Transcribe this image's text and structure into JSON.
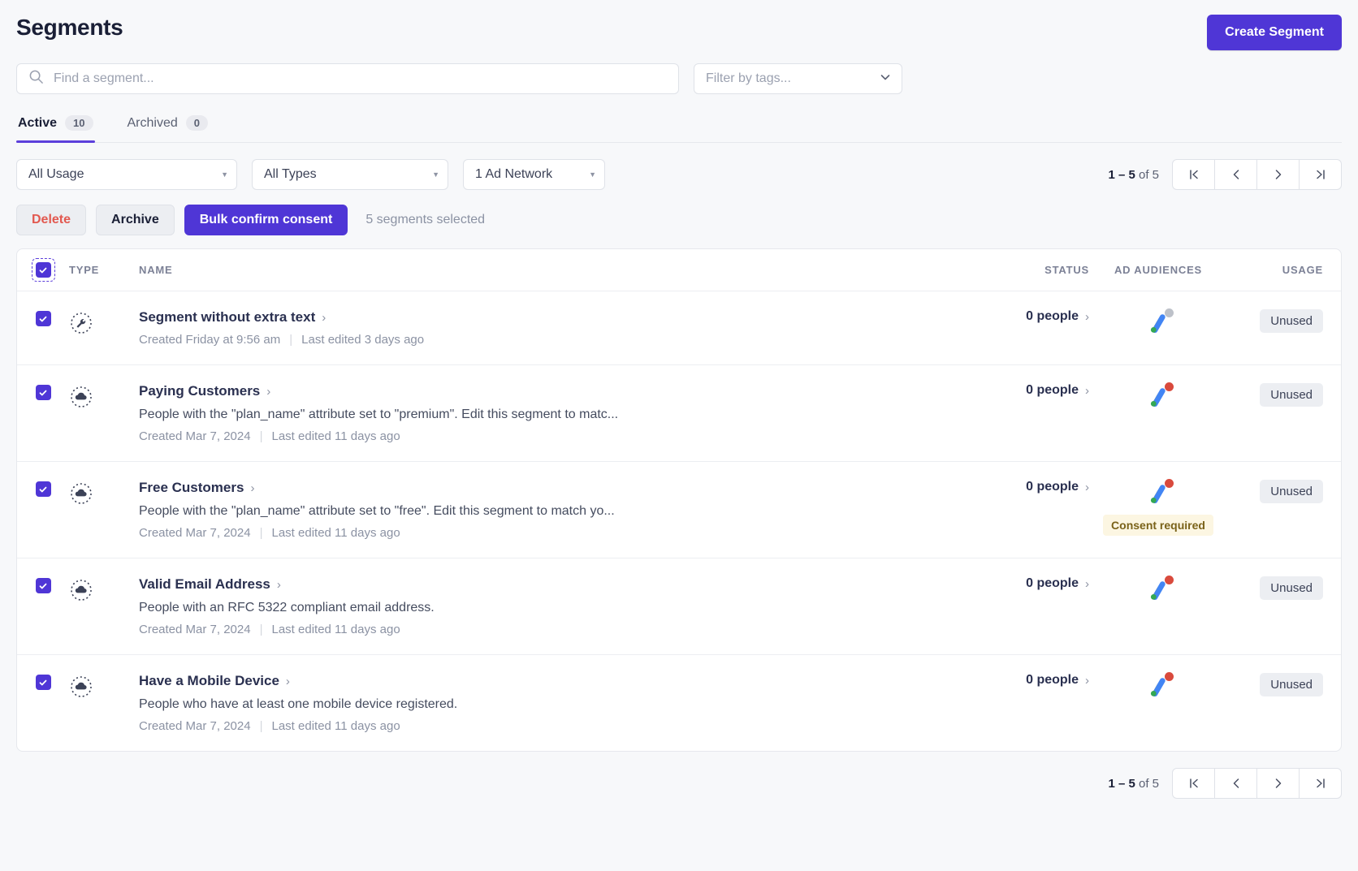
{
  "header": {
    "title": "Segments",
    "create_button": "Create Segment"
  },
  "search": {
    "placeholder": "Find a segment...",
    "value": "",
    "tag_filter_placeholder": "Filter by tags..."
  },
  "tabs": [
    {
      "label": "Active",
      "count": "10",
      "active": true
    },
    {
      "label": "Archived",
      "count": "0",
      "active": false
    }
  ],
  "filters": [
    {
      "name": "usage",
      "value": "All Usage"
    },
    {
      "name": "types",
      "value": "All Types"
    },
    {
      "name": "network",
      "value": "1 Ad Network"
    }
  ],
  "pagination": {
    "range_prefix": "1 – 5",
    "range_suffix": " of 5",
    "first_label": "first-page",
    "prev_label": "previous-page",
    "next_label": "next-page",
    "last_label": "last-page"
  },
  "bulk_actions": {
    "delete": "Delete",
    "archive": "Archive",
    "confirm_consent": "Bulk confirm consent",
    "selection_note": "5 segments selected"
  },
  "table": {
    "columns": {
      "type": "TYPE",
      "name": "NAME",
      "status": "STATUS",
      "ad_audiences": "AD AUDIENCES",
      "usage": "USAGE"
    },
    "select_all_checked": true,
    "rows": [
      {
        "checked": true,
        "type_icon": "wrench-circle-icon",
        "name": "Segment without extra text",
        "description": "",
        "created": "Created Friday at 9:56 am",
        "last_edited": "Last edited 3 days ago",
        "status": "0 people",
        "ad_network_icon": "google-ads-icon",
        "badge_color": "#bdc1c9",
        "consent_required": "",
        "usage": "Unused"
      },
      {
        "checked": true,
        "type_icon": "cloud-circle-icon",
        "name": "Paying Customers",
        "description": "People with the \"plan_name\" attribute set to \"premium\". Edit this segment to matc...",
        "created": "Created Mar 7, 2024",
        "last_edited": "Last edited 11 days ago",
        "status": "0 people",
        "ad_network_icon": "google-ads-icon",
        "badge_color": "#d94a3d",
        "consent_required": "",
        "usage": "Unused"
      },
      {
        "checked": true,
        "type_icon": "cloud-circle-icon",
        "name": "Free Customers",
        "description": "People with the \"plan_name\" attribute set to \"free\". Edit this segment to match yo...",
        "created": "Created Mar 7, 2024",
        "last_edited": "Last edited 11 days ago",
        "status": "0 people",
        "ad_network_icon": "google-ads-icon",
        "badge_color": "#d94a3d",
        "consent_required": "Consent required",
        "usage": "Unused"
      },
      {
        "checked": true,
        "type_icon": "cloud-circle-icon",
        "name": "Valid Email Address",
        "description": "People with an RFC 5322 compliant email address.",
        "created": "Created Mar 7, 2024",
        "last_edited": "Last edited 11 days ago",
        "status": "0 people",
        "ad_network_icon": "google-ads-icon",
        "badge_color": "#d94a3d",
        "consent_required": "",
        "usage": "Unused"
      },
      {
        "checked": true,
        "type_icon": "cloud-circle-icon",
        "name": "Have a Mobile Device",
        "description": "People who have at least one mobile device registered.",
        "created": "Created Mar 7, 2024",
        "last_edited": "Last edited 11 days ago",
        "status": "0 people",
        "ad_network_icon": "google-ads-icon",
        "badge_color": "#d94a3d",
        "consent_required": "",
        "usage": "Unused"
      }
    ]
  },
  "colors": {
    "accent": "#4f36d6",
    "tab_underline": "#5c3fdb",
    "delete_text": "#e25950",
    "consent_bg": "#fcf6e2",
    "consent_text": "#7a6219"
  }
}
